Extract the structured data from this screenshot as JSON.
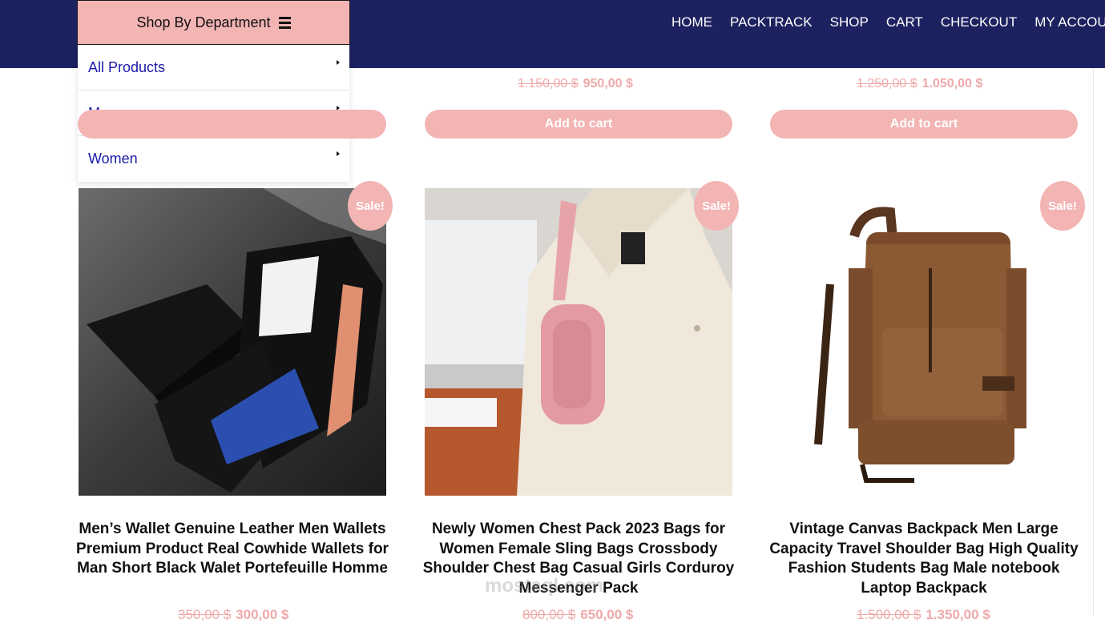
{
  "nav": {
    "items": [
      "HOME",
      "PACKTRACK",
      "SHOP",
      "CART",
      "CHECKOUT",
      "MY ACCOU"
    ]
  },
  "department": {
    "label": "Shop By Department",
    "items": [
      "All Products",
      "Men",
      "Women"
    ]
  },
  "top_row": {
    "prices": [
      {
        "old": "1.150,00 $",
        "new": "950,00 $"
      },
      {
        "old": "1.250,00 $",
        "new": "1.050,00 $"
      }
    ],
    "button_label": "Add to cart"
  },
  "products": [
    {
      "badge": "Sale!",
      "title": "Men’s Wallet Genuine Leather Men Wallets Premium Product Real Cowhide Wallets for Man Short Black Walet Portefeuille Homme",
      "old_price": "350,00 $",
      "new_price": "300,00 $"
    },
    {
      "badge": "Sale!",
      "title": "Newly Women Chest Pack 2023 Bags for Women Female Sling Bags Crossbody Shoulder Chest Bag Casual Girls Corduroy Messenger Pack",
      "old_price": "800,00 $",
      "new_price": "650,00 $"
    },
    {
      "badge": "Sale!",
      "title": "Vintage Canvas Backpack Men Large Capacity Travel Shoulder Bag High Quality Fashion Students Bag Male notebook Laptop Backpack",
      "old_price": "1.500,00 $",
      "new_price": "1.350,00 $"
    }
  ],
  "watermark": "mostaql.com",
  "colors": {
    "header": "#1c2160",
    "accent": "#f3b4b4",
    "menu_link": "#1a1aa6"
  }
}
